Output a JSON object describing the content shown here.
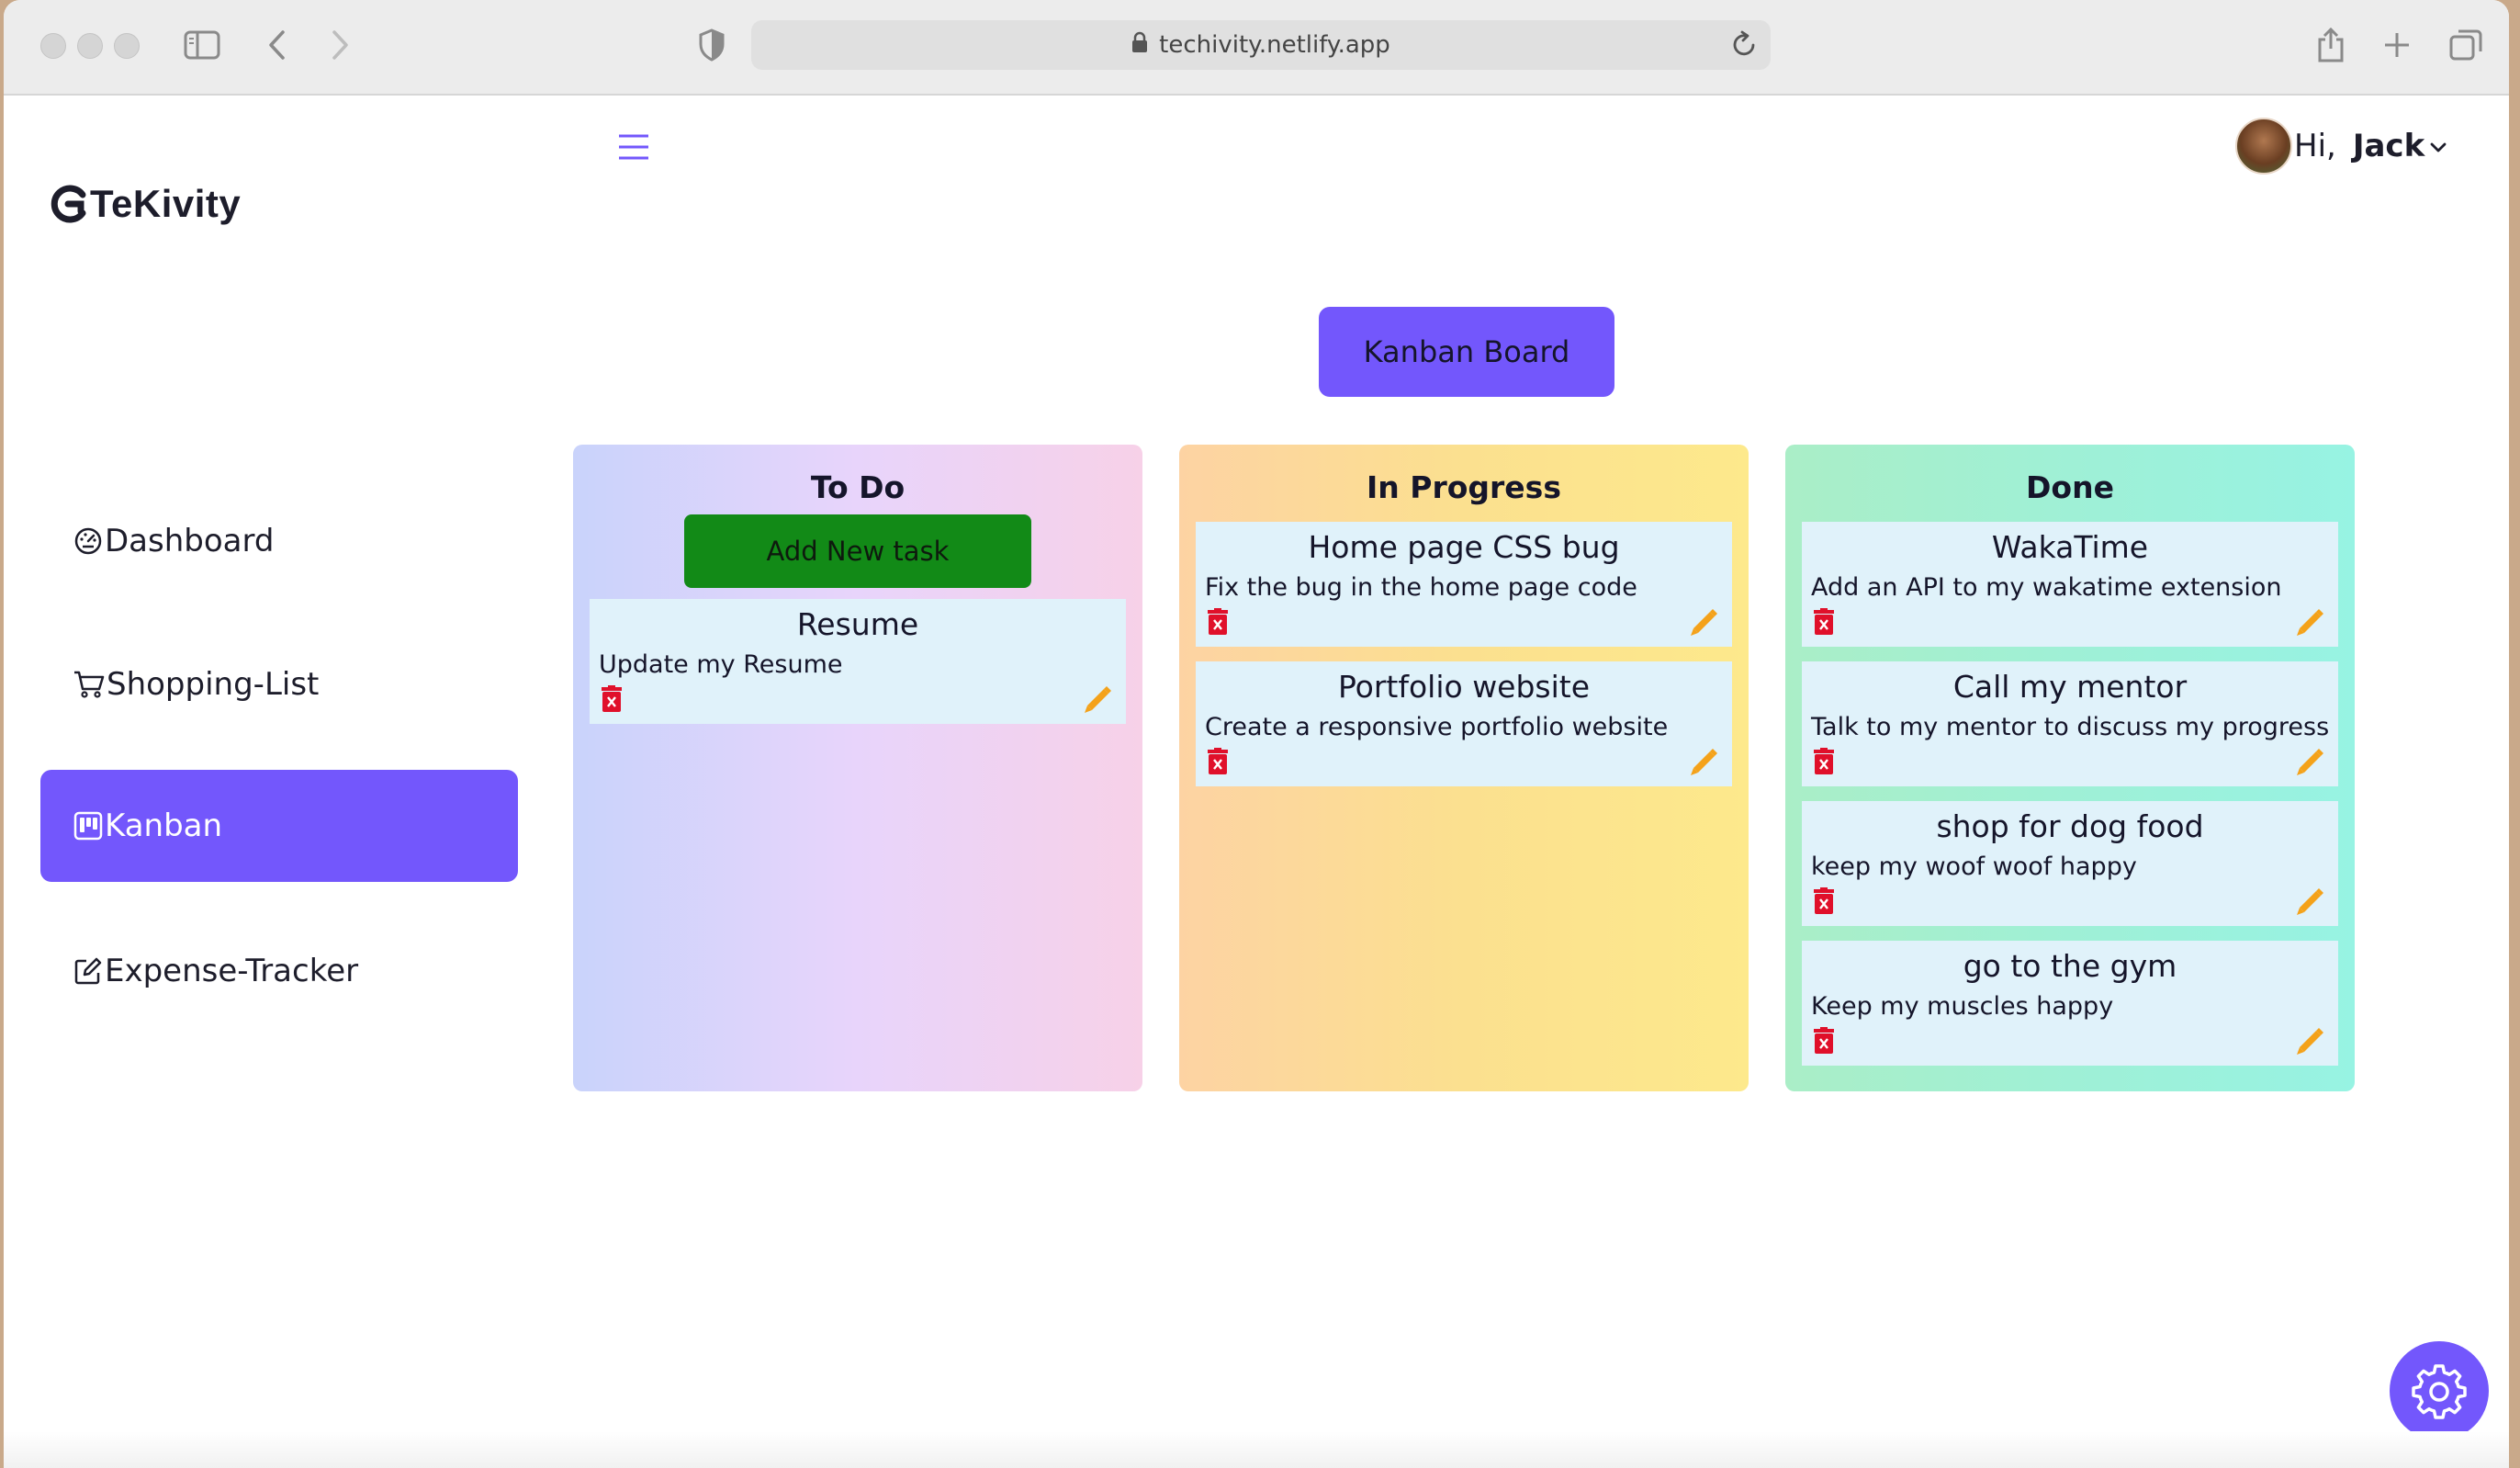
{
  "browser": {
    "url": "techivity.netlify.app"
  },
  "app": {
    "logo_text": "TeKivity",
    "user": {
      "greeting": "Hi,",
      "name": "Jack"
    },
    "accent_color": "#7357fc"
  },
  "sidebar": {
    "items": [
      {
        "label": "Dashboard",
        "icon": "dashboard-gauge-icon",
        "active": false
      },
      {
        "label": "Shopping-List",
        "icon": "cart-icon",
        "active": false
      },
      {
        "label": "Kanban",
        "icon": "kanban-board-icon",
        "active": true
      },
      {
        "label": "Expense-Tracker",
        "icon": "edit-square-icon",
        "active": false
      }
    ]
  },
  "board": {
    "title": "Kanban Board",
    "add_task_label": "Add New task",
    "columns": [
      {
        "title": "To Do",
        "cards": [
          {
            "title": "Resume",
            "description": "Update my Resume"
          }
        ]
      },
      {
        "title": "In Progress",
        "cards": [
          {
            "title": "Home page CSS bug",
            "description": "Fix the bug in the home page code"
          },
          {
            "title": "Portfolio website",
            "description": "Create a responsive portfolio website"
          }
        ]
      },
      {
        "title": "Done",
        "cards": [
          {
            "title": "WakaTime",
            "description": "Add an API to my wakatime extension"
          },
          {
            "title": "Call my mentor",
            "description": "Talk to my mentor to discuss my progress"
          },
          {
            "title": "shop for dog food",
            "description": "keep my woof woof happy"
          },
          {
            "title": "go to the gym",
            "description": "Keep my muscles happy"
          }
        ]
      }
    ]
  }
}
